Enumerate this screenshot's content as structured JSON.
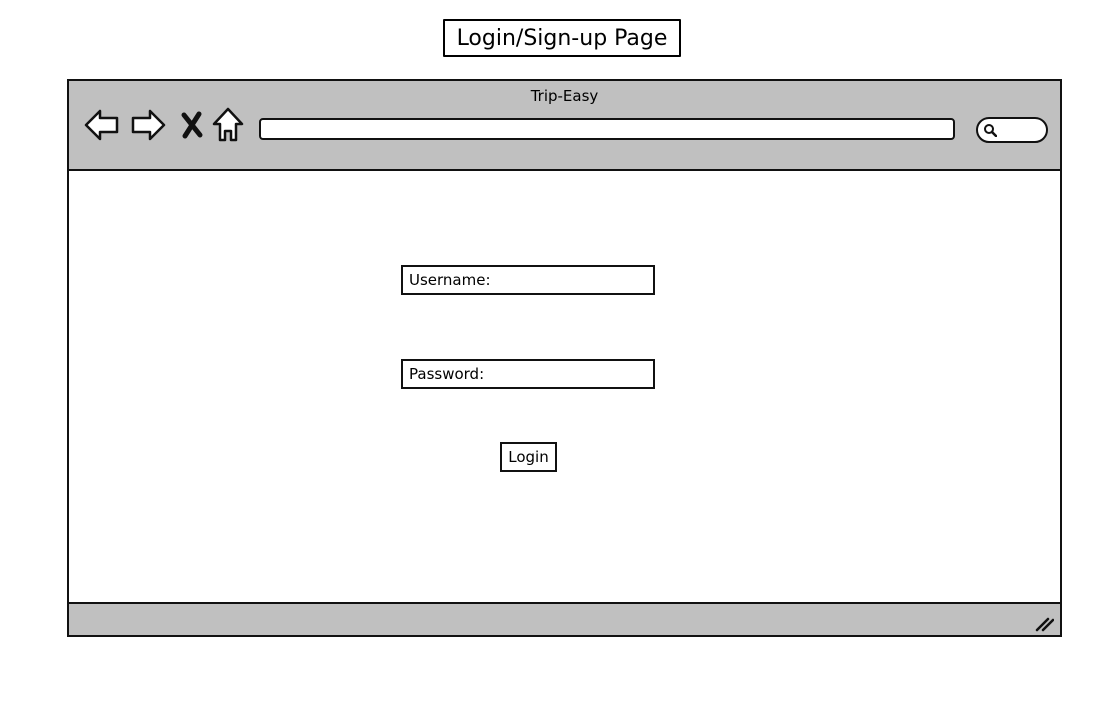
{
  "page_heading": "Login/Sign-up Page",
  "browser": {
    "window_title": "Trip-Easy",
    "toolbar": {
      "back_icon": "back-arrow-icon",
      "forward_icon": "forward-arrow-icon",
      "stop_icon": "close-icon",
      "home_icon": "home-icon",
      "address_value": "",
      "search_icon": "search-icon"
    },
    "colors": {
      "chrome": "#c0c0c0",
      "stroke": "#111111",
      "content_bg": "#ffffff"
    }
  },
  "form": {
    "username_label": "Username:",
    "username_value": "",
    "password_label": "Password:",
    "password_value": "",
    "login_label": "Login"
  },
  "statusbar": {
    "resize_icon": "resize-grip-icon"
  }
}
